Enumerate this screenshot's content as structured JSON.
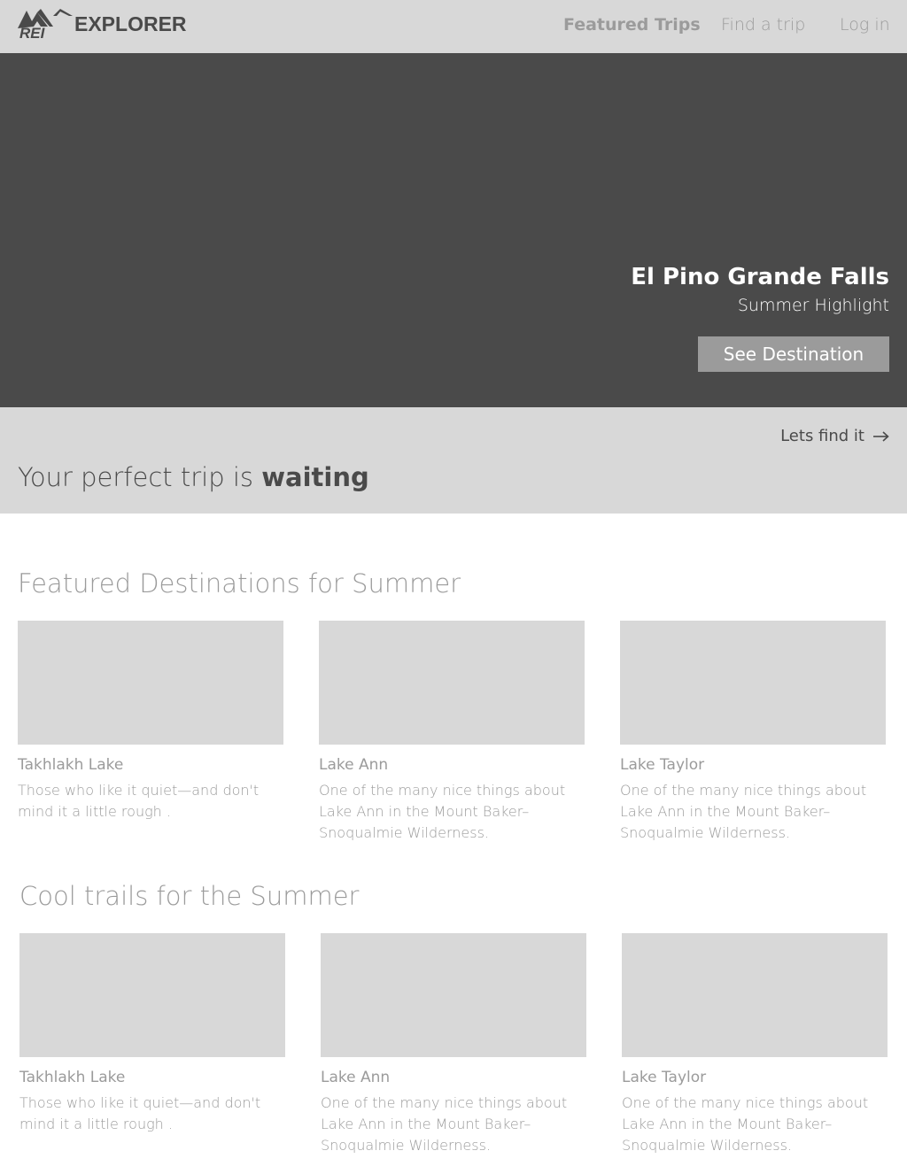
{
  "header": {
    "brand": "EXPLORER",
    "logo_mark": "REI",
    "nav": {
      "featured": "Featured Trips",
      "find": "Find a trip",
      "login": "Log in"
    }
  },
  "hero": {
    "title": "El Pino Grande Falls",
    "subtitle": "Summer Highlight",
    "button": "See Destination"
  },
  "band": {
    "link": "Lets find it",
    "headline_prefix": "Your perfect trip is",
    "headline_emphasis": "waiting"
  },
  "featured": {
    "title": "Featured Destinations for Summer",
    "cards": [
      {
        "title": "Takhlakh Lake",
        "desc": "Those who like it quiet—and don't mind it a little rough ."
      },
      {
        "title": "Lake Ann",
        "desc": "One of the many nice things about Lake Ann in the Mount Baker–Snoqualmie Wilderness."
      },
      {
        "title": "Lake Taylor",
        "desc": "One of the many nice things about Lake Ann in the Mount Baker–Snoqualmie Wilderness."
      }
    ]
  },
  "trails": {
    "title": "Cool trails for the Summer",
    "cards": [
      {
        "title": "Takhlakh Lake",
        "desc": "Those who like it quiet—and don't mind it a little rough ."
      },
      {
        "title": "Lake Ann",
        "desc": "One of the many nice things about Lake Ann in the Mount Baker–Snoqualmie Wilderness."
      },
      {
        "title": "Lake Taylor",
        "desc": "One of the many nice things about Lake Ann in the Mount Baker–Snoqualmie Wilderness."
      }
    ]
  },
  "colors": {
    "header_bg": "#d8d8d8",
    "hero_bg": "#4a4a4a",
    "button_bg": "#9b9b9b",
    "placeholder": "#d8d8d8",
    "muted_text": "#9b9b9b",
    "dark_text": "#4a4a4a"
  },
  "icons": {
    "logo": "rei-logo-icon",
    "arrow": "arrow-right-icon"
  }
}
